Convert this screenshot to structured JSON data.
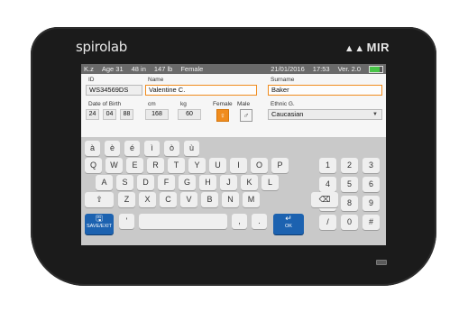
{
  "device": {
    "brand": "spirolab",
    "manufacturer": "MIR"
  },
  "status_bar": {
    "patient_initials": "K.z",
    "age": "Age 31",
    "height": "48 in",
    "weight": "147 lb",
    "sex": "Female",
    "date": "21/01/2016",
    "time": "17:53",
    "version": "Ver. 2.0",
    "battery_level": 0.75
  },
  "form": {
    "id_label": "ID",
    "id_value": "WS34569DS",
    "name_label": "Name",
    "name_value": "Valentine C.",
    "surname_label": "Surname",
    "surname_value": "Baker",
    "dob_label": "Date of Birth",
    "dob_day": "24",
    "dob_month": "04",
    "dob_year": "88",
    "cm_label": "cm",
    "cm_value": "168",
    "kg_label": "kg",
    "kg_value": "60",
    "female_label": "Female",
    "male_label": "Male",
    "ethnic_label": "Ethnic G.",
    "ethnic_value": "Caucasian"
  },
  "keyboard": {
    "accent_row": [
      "à",
      "è",
      "é",
      "ì",
      "ò",
      "ù"
    ],
    "row1": [
      "Q",
      "W",
      "E",
      "R",
      "T",
      "Y",
      "U",
      "I",
      "O",
      "P"
    ],
    "row2": [
      "A",
      "S",
      "D",
      "F",
      "G",
      "H",
      "J",
      "K",
      "L"
    ],
    "row3": [
      "Z",
      "X",
      "C",
      "V",
      "B",
      "N",
      "M"
    ],
    "numpad": [
      "1",
      "2",
      "3",
      "4",
      "5",
      "6",
      "7",
      "8",
      "9",
      "/",
      "0",
      "#"
    ],
    "apostrophe": "'",
    "comma": ",",
    "period": ".",
    "save_exit_label": "SAVE/EXIT",
    "ok_label": "OK"
  },
  "colors": {
    "accent_orange": "#f08c1e",
    "key_blue": "#1c62b0",
    "battery_green": "#48c447"
  }
}
